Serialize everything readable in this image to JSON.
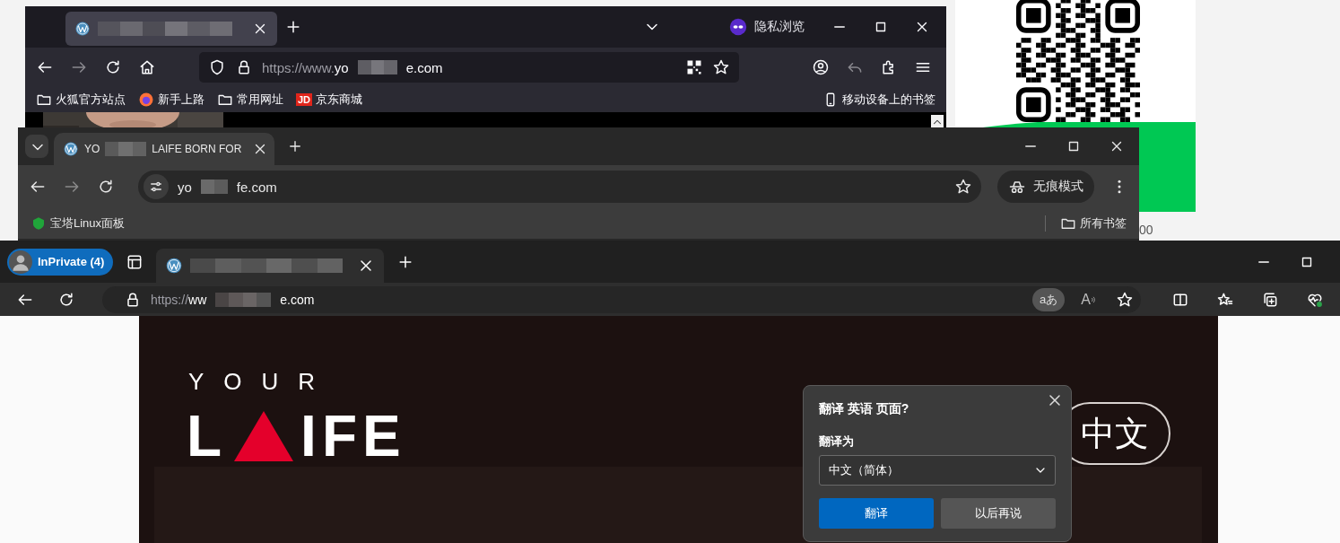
{
  "qr_panel": {
    "caption": "00"
  },
  "firefox": {
    "tab": {
      "selected": true
    },
    "private_label": "隐私浏览",
    "nav_buttons": [
      {
        "kind": "back",
        "disabled": false
      },
      {
        "kind": "forward",
        "disabled": true
      },
      {
        "kind": "reload",
        "disabled": false
      },
      {
        "kind": "home",
        "disabled": false
      }
    ],
    "url": {
      "scheme": "https://www.",
      "host_start": "yo",
      "host_end": "e.com"
    },
    "toolbar_right": [
      {
        "kind": "account",
        "disabled": false
      },
      {
        "kind": "undo",
        "disabled": true
      },
      {
        "kind": "extension",
        "disabled": false
      },
      {
        "kind": "menu",
        "disabled": false
      }
    ],
    "bookmarks": [
      {
        "kind": "folder",
        "label": "火狐官方站点"
      },
      {
        "kind": "firefox",
        "label": "新手上路"
      },
      {
        "kind": "folder",
        "label": "常用网址"
      },
      {
        "kind": "jd",
        "badge": "JD",
        "label": "京东商城"
      }
    ],
    "mobile_bookmarks": "移动设备上的书签"
  },
  "chrome": {
    "tab": {
      "title_start": "YO",
      "title_end": "LAIFE BORN FOR",
      "selected": true
    },
    "nav_buttons": [
      {
        "kind": "back",
        "disabled": false
      },
      {
        "kind": "forward",
        "disabled": true
      },
      {
        "kind": "reload",
        "disabled": false
      }
    ],
    "url": {
      "start": "yo",
      "end": "fe.com"
    },
    "incognito_label": "无痕模式",
    "bookmarks": [
      {
        "kind": "baota",
        "label": "宝塔Linux面板"
      }
    ],
    "all_bookmarks": "所有书签"
  },
  "edge": {
    "profile": "InPrivate (4)",
    "tab": {
      "selected": true
    },
    "nav_buttons": [
      {
        "kind": "back",
        "disabled": false
      },
      {
        "kind": "reload",
        "disabled": false
      }
    ],
    "url": {
      "scheme": "https://",
      "host_start": "ww",
      "host_end": "e.com"
    },
    "translate_chip": {
      "label": "aあ",
      "active": true
    },
    "read_aloud": "A",
    "toolbar_right": [
      {
        "kind": "split"
      },
      {
        "kind": "favorites"
      },
      {
        "kind": "collections"
      },
      {
        "kind": "health"
      }
    ],
    "page": {
      "logo_top": "YOUR",
      "logo_left": "L",
      "logo_right": "IFE",
      "language_button": "中文"
    },
    "translate_popup": {
      "title": "翻译 英语 页面?",
      "target_label": "翻译为",
      "target_value": "中文（简体）",
      "buttons": [
        {
          "label": "翻译",
          "kind": "primary"
        },
        {
          "label": "以后再说",
          "kind": "secondary"
        }
      ]
    }
  }
}
